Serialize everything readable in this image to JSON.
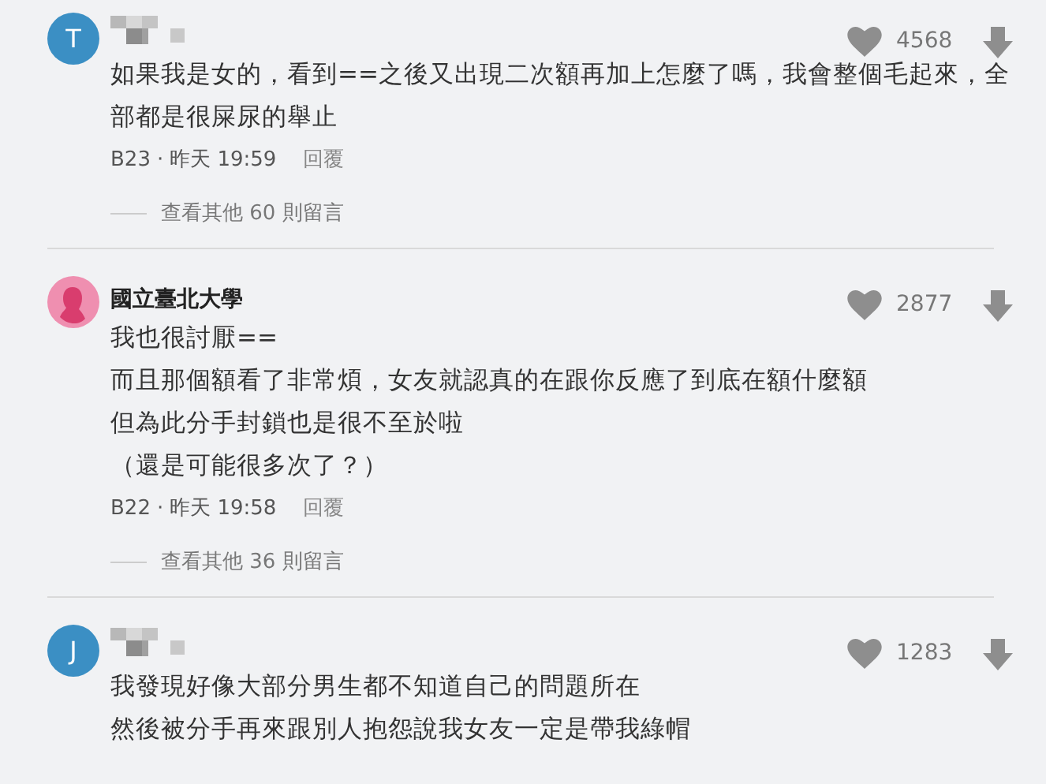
{
  "comments": [
    {
      "avatar": {
        "kind": "letter",
        "letter": "T",
        "color": "#3b8fc4"
      },
      "author": {
        "kind": "pixelated"
      },
      "likes": "4568",
      "paragraphs": [
        "如果我是女的，看到==之後又出現二次額再加上怎麼了嗎，我會整個毛起來，全部都是很屎尿的舉止"
      ],
      "floor": "B23",
      "separator": "·",
      "time": "昨天 19:59",
      "reply": "回覆",
      "more_replies": "查看其他 60 則留言"
    },
    {
      "avatar": {
        "kind": "silhouette",
        "color": "#ef8fb0"
      },
      "author": {
        "kind": "name",
        "name": "國立臺北大學"
      },
      "likes": "2877",
      "paragraphs": [
        "我也很討厭==",
        "而且那個額看了非常煩，女友就認真的在跟你反應了到底在額什麼額",
        "但為此分手封鎖也是很不至於啦",
        "（還是可能很多次了？）"
      ],
      "floor": "B22",
      "separator": "·",
      "time": "昨天 19:58",
      "reply": "回覆",
      "more_replies": "查看其他 36 則留言"
    },
    {
      "avatar": {
        "kind": "letter",
        "letter": "J",
        "color": "#3b8fc4"
      },
      "author": {
        "kind": "pixelated"
      },
      "likes": "1283",
      "paragraphs": [
        "我發現好像大部分男生都不知道自己的問題所在",
        "然後被分手再來跟別人抱怨說我女友一定是帶我綠帽"
      ]
    }
  ]
}
